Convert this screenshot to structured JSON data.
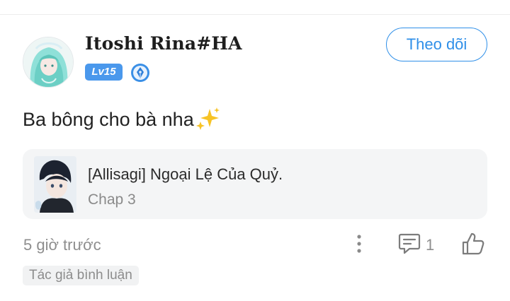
{
  "comment": {
    "author": {
      "name": "Itoshi Rina#HA",
      "level": "Lv15",
      "avatar_icon": "anime-girl-avatar-icon",
      "rank_icon": "pen-nib-rank-icon"
    },
    "follow_label": "Theo dõi",
    "text": "Ba bông cho bà nha",
    "text_emoji_icon": "sparkles-icon",
    "manga": {
      "title": "[Allisagi] Ngoại Lệ Của Quỷ.",
      "chapter": "Chap 3",
      "thumb_icon": "manga-cover-thumbnail"
    },
    "timestamp": "5 giờ trước",
    "reply_count": "1",
    "author_tag": "Tác giả bình luận"
  },
  "colors": {
    "accent": "#2f8fe8",
    "level_badge": "#4a98ec",
    "card_bg": "#f4f5f6",
    "muted_text": "#8e8e8e"
  }
}
